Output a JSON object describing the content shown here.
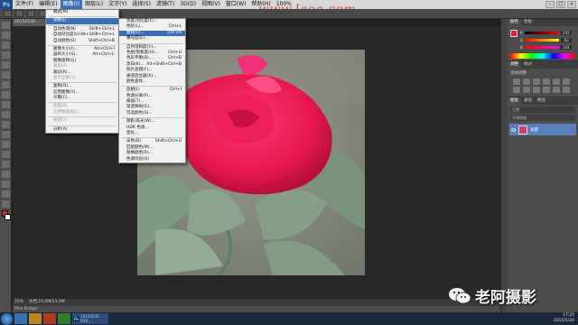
{
  "app": {
    "logo": "Ps"
  },
  "menubar": {
    "items": [
      "文件(F)",
      "编辑(E)",
      "图像(I)",
      "图层(L)",
      "文字(Y)",
      "选择(S)",
      "滤镜(T)",
      "3D(D)",
      "视图(V)",
      "窗口(W)",
      "帮助(H)"
    ],
    "active_index": 2,
    "zoom": "100%"
  },
  "doc": {
    "tab_title": "20150530 ...",
    "status_zoom": "25%",
    "status_info": "文档:23.0M/23.0M",
    "mini_bridge": "Mini Bridge"
  },
  "image_menu": {
    "items": [
      {
        "label": "模式(M)",
        "shortcut": "",
        "state": "normal"
      },
      {
        "sep": true
      },
      {
        "label": "调整(J)",
        "shortcut": "",
        "state": "highlight"
      },
      {
        "sep": true
      },
      {
        "label": "自动色调(N)",
        "shortcut": "Shift+Ctrl+L",
        "state": "normal"
      },
      {
        "label": "自动对比度(U)",
        "shortcut": "Alt+Shift+Ctrl+L",
        "state": "normal"
      },
      {
        "label": "自动颜色(O)",
        "shortcut": "Shift+Ctrl+B",
        "state": "normal"
      },
      {
        "sep": true
      },
      {
        "label": "图像大小(I)...",
        "shortcut": "Alt+Ctrl+I",
        "state": "normal"
      },
      {
        "label": "画布大小(S)...",
        "shortcut": "Alt+Ctrl+C",
        "state": "normal"
      },
      {
        "label": "图像旋转(G)",
        "shortcut": "",
        "state": "normal"
      },
      {
        "label": "裁剪(P)",
        "shortcut": "",
        "state": "disabled"
      },
      {
        "label": "裁切(R)...",
        "shortcut": "",
        "state": "normal"
      },
      {
        "label": "显示全部(V)",
        "shortcut": "",
        "state": "disabled"
      },
      {
        "sep": true
      },
      {
        "label": "复制(D)...",
        "shortcut": "",
        "state": "normal"
      },
      {
        "label": "应用图像(Y)...",
        "shortcut": "",
        "state": "normal"
      },
      {
        "label": "计算(C)...",
        "shortcut": "",
        "state": "normal"
      },
      {
        "sep": true
      },
      {
        "label": "变量(B)",
        "shortcut": "",
        "state": "disabled"
      },
      {
        "label": "应用数据组(L)...",
        "shortcut": "",
        "state": "disabled"
      },
      {
        "sep": true
      },
      {
        "label": "陷印(T)...",
        "shortcut": "",
        "state": "disabled"
      },
      {
        "sep": true
      },
      {
        "label": "分析(A)",
        "shortcut": "",
        "state": "normal"
      }
    ]
  },
  "adjust_submenu": {
    "items": [
      {
        "label": "亮度/对比度(C)...",
        "shortcut": "",
        "state": "normal"
      },
      {
        "label": "色阶(L)...",
        "shortcut": "Ctrl+L",
        "state": "normal"
      },
      {
        "label": "曲线(U)...",
        "shortcut": "Ctrl+M",
        "state": "highlight"
      },
      {
        "label": "曝光度(E)...",
        "shortcut": "",
        "state": "normal"
      },
      {
        "sep": true
      },
      {
        "label": "自然饱和度(V)...",
        "shortcut": "",
        "state": "normal"
      },
      {
        "label": "色相/饱和度(H)...",
        "shortcut": "Ctrl+U",
        "state": "normal"
      },
      {
        "label": "色彩平衡(B)...",
        "shortcut": "Ctrl+B",
        "state": "normal"
      },
      {
        "label": "黑白(K)...",
        "shortcut": "Alt+Shift+Ctrl+B",
        "state": "normal"
      },
      {
        "label": "照片滤镜(F)...",
        "shortcut": "",
        "state": "normal"
      },
      {
        "label": "通道混合器(X)...",
        "shortcut": "",
        "state": "normal"
      },
      {
        "label": "颜色查找...",
        "shortcut": "",
        "state": "normal"
      },
      {
        "sep": true
      },
      {
        "label": "反相(I)",
        "shortcut": "Ctrl+I",
        "state": "normal"
      },
      {
        "label": "色调分离(P)...",
        "shortcut": "",
        "state": "normal"
      },
      {
        "label": "阈值(T)...",
        "shortcut": "",
        "state": "normal"
      },
      {
        "label": "渐变映射(G)...",
        "shortcut": "",
        "state": "normal"
      },
      {
        "label": "可选颜色(S)...",
        "shortcut": "",
        "state": "normal"
      },
      {
        "sep": true
      },
      {
        "label": "阴影/高光(W)...",
        "shortcut": "",
        "state": "normal"
      },
      {
        "label": "HDR 色调...",
        "shortcut": "",
        "state": "normal"
      },
      {
        "label": "变化...",
        "shortcut": "",
        "state": "normal"
      },
      {
        "sep": true
      },
      {
        "label": "去色(D)",
        "shortcut": "Shift+Ctrl+U",
        "state": "normal"
      },
      {
        "label": "匹配颜色(M)...",
        "shortcut": "",
        "state": "normal"
      },
      {
        "label": "替换颜色(R)...",
        "shortcut": "",
        "state": "normal"
      },
      {
        "label": "色调均化(Q)",
        "shortcut": "",
        "state": "normal"
      }
    ]
  },
  "panels": {
    "color_tabs": [
      "颜色",
      "色板"
    ],
    "rgb_values": [
      "255",
      "62",
      "104"
    ],
    "adjust_tabs": [
      "调整",
      "样式"
    ],
    "adjust_title": "添加调整",
    "layers_tabs": [
      "图层",
      "通道",
      "路径"
    ],
    "layer_name": "背景",
    "blend_mode": "正常",
    "opacity": "不透明度"
  },
  "taskbar": {
    "ps_task": "20150530 RX4..",
    "clock_time": "17:25",
    "clock_date": "2015/5/30"
  },
  "watermarks": {
    "url": "www.laoa.com",
    "brand": "老阿摄影"
  },
  "colors": {
    "rose": "#e8184e",
    "menu_highlight": "#3b6fb6",
    "panel_bg": "#4c4c4c"
  }
}
